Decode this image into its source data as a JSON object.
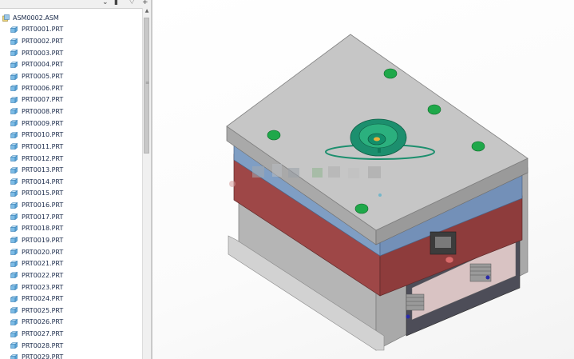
{
  "model_tree": {
    "root": {
      "label": "ASM0002.ASM",
      "icon": "assembly-icon"
    },
    "items": [
      "PRT0001.PRT",
      "PRT0002.PRT",
      "PRT0003.PRT",
      "PRT0004.PRT",
      "PRT0005.PRT",
      "PRT0006.PRT",
      "PRT0007.PRT",
      "PRT0008.PRT",
      "PRT0009.PRT",
      "PRT0010.PRT",
      "PRT0011.PRT",
      "PRT0012.PRT",
      "PRT0013.PRT",
      "PRT0014.PRT",
      "PRT0015.PRT",
      "PRT0016.PRT",
      "PRT0017.PRT",
      "PRT0018.PRT",
      "PRT0019.PRT",
      "PRT0020.PRT",
      "PRT0021.PRT",
      "PRT0022.PRT",
      "PRT0023.PRT",
      "PRT0024.PRT",
      "PRT0025.PRT",
      "PRT0026.PRT",
      "PRT0027.PRT",
      "PRT0028.PRT",
      "PRT0029.PRT"
    ],
    "item_icon": "part-icon"
  },
  "toolbar": {
    "buttons": [
      "chevron-down-icon",
      "settings-icon",
      "filter-icon",
      "add-icon"
    ]
  },
  "viewport": {
    "model": "injection-mold-assembly",
    "colors": {
      "top_plate": "#c6c6c6",
      "blue_plate": "#7f9ec4",
      "red_plate": "#9e4747",
      "base_gray": "#c3c3c3",
      "green_feature": "#1fa84a",
      "sprue_bushing": "#1c8f6e"
    }
  }
}
